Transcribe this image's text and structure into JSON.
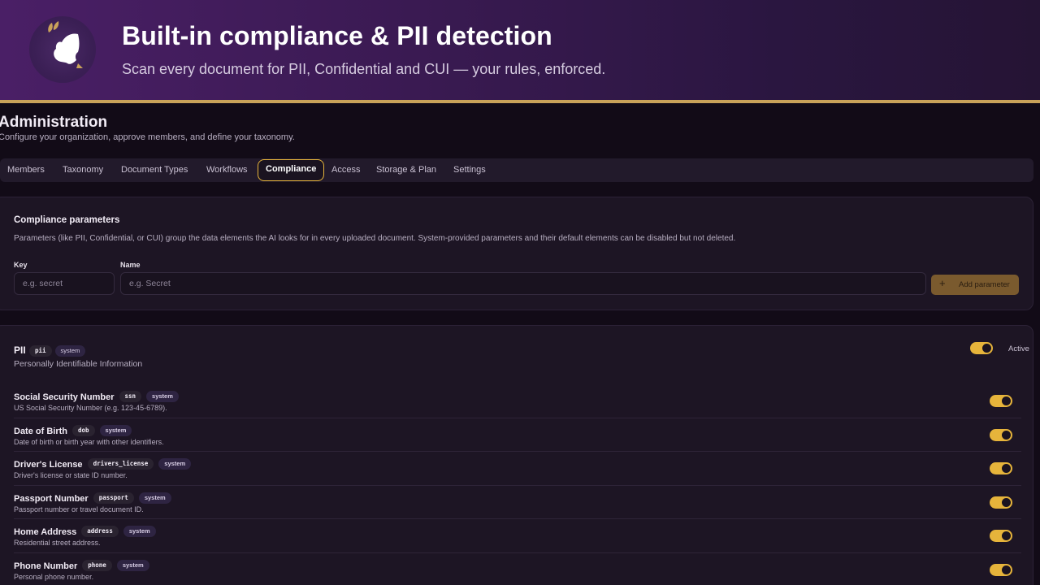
{
  "banner": {
    "title": "Built-in compliance & PII detection",
    "subtitle": "Scan every document for PII, Confidential and CUI — your rules, enforced."
  },
  "admin": {
    "title": "Administration",
    "subtitle": "Configure your organization, approve members, and define your taxonomy."
  },
  "tabs": [
    {
      "label": "Members"
    },
    {
      "label": "Taxonomy"
    },
    {
      "label": "Document Types"
    },
    {
      "label": "Workflows"
    },
    {
      "label": "Compliance",
      "active": true
    },
    {
      "label": "Access"
    },
    {
      "label": "Storage & Plan"
    },
    {
      "label": "Settings"
    }
  ],
  "compliance": {
    "title": "Compliance parameters",
    "description": "Parameters (like PII, Confidential, or CUI) group the data elements the AI looks for in every uploaded document. System-provided parameters and their default elements can be disabled but not deleted.",
    "key_label": "Key",
    "key_placeholder": "e.g. secret",
    "name_label": "Name",
    "name_placeholder": "e.g. Secret",
    "add_button": "Add parameter",
    "add_icon": "+"
  },
  "parameter": {
    "name": "PII",
    "key": "pii",
    "badge": "system",
    "description": "Personally Identifiable Information",
    "status_label": "Active",
    "active": true
  },
  "elements": [
    {
      "name": "Social Security Number",
      "key": "ssn",
      "badge": "system",
      "description": "US Social Security Number (e.g. 123-45-6789).",
      "enabled": true
    },
    {
      "name": "Date of Birth",
      "key": "dob",
      "badge": "system",
      "description": "Date of birth or birth year with other identifiers.",
      "enabled": true
    },
    {
      "name": "Driver's License",
      "key": "drivers_license",
      "badge": "system",
      "description": "Driver's license or state ID number.",
      "enabled": true
    },
    {
      "name": "Passport Number",
      "key": "passport",
      "badge": "system",
      "description": "Passport number or travel document ID.",
      "enabled": true
    },
    {
      "name": "Home Address",
      "key": "address",
      "badge": "system",
      "description": "Residential street address.",
      "enabled": true
    },
    {
      "name": "Phone Number",
      "key": "phone",
      "badge": "system",
      "description": "Personal phone number.",
      "enabled": true
    }
  ],
  "colors": {
    "accent": "#e6b43b",
    "banner_start": "#4a1f66",
    "banner_line": "#c9a25a",
    "background": "#120b17"
  },
  "icons": {
    "logo": "woman-profile-leaf-logo",
    "add": "plus-icon"
  }
}
